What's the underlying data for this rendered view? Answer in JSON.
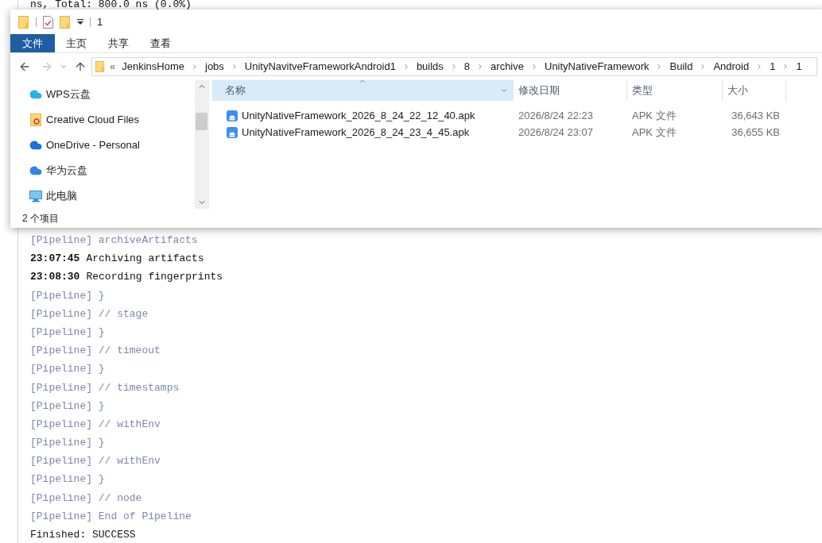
{
  "log": {
    "top_line": "ns, Total: 800.0 ns (0.0%)",
    "lines": [
      {
        "kind": "pipeline",
        "text": "[Pipeline] archiveArtifacts"
      },
      {
        "kind": "timestamped",
        "time": "23:07:45",
        "text": "Archiving artifacts"
      },
      {
        "kind": "timestamped",
        "time": "23:08:30",
        "text": "Recording fingerprints"
      },
      {
        "kind": "pipeline",
        "text": "[Pipeline] }"
      },
      {
        "kind": "pipeline",
        "text": "[Pipeline] // stage"
      },
      {
        "kind": "pipeline",
        "text": "[Pipeline] }"
      },
      {
        "kind": "pipeline",
        "text": "[Pipeline] // timeout"
      },
      {
        "kind": "pipeline",
        "text": "[Pipeline] }"
      },
      {
        "kind": "pipeline",
        "text": "[Pipeline] // timestamps"
      },
      {
        "kind": "pipeline",
        "text": "[Pipeline] }"
      },
      {
        "kind": "pipeline",
        "text": "[Pipeline] // withEnv"
      },
      {
        "kind": "pipeline",
        "text": "[Pipeline] }"
      },
      {
        "kind": "pipeline",
        "text": "[Pipeline] // withEnv"
      },
      {
        "kind": "pipeline",
        "text": "[Pipeline] }"
      },
      {
        "kind": "pipeline",
        "text": "[Pipeline] // node"
      },
      {
        "kind": "pipeline",
        "text": "[Pipeline] End of Pipeline"
      },
      {
        "kind": "plain",
        "text": "Finished: SUCCESS"
      }
    ]
  },
  "explorer": {
    "window": {
      "title": "1"
    },
    "ribbon_tabs": [
      {
        "label": "文件",
        "selected": true
      },
      {
        "label": "主页",
        "selected": false
      },
      {
        "label": "共享",
        "selected": false
      },
      {
        "label": "查看",
        "selected": false
      }
    ],
    "navigation": {
      "forward_disabled": true
    },
    "address": {
      "overflow": "«",
      "crumbs": [
        "JenkinsHome",
        "jobs",
        "UnityNavitveFrameworkAndroid1",
        "builds",
        "8",
        "archive",
        "UnityNativeFramework",
        "Build",
        "Android",
        "1",
        "1"
      ]
    },
    "sidebar": {
      "items": [
        {
          "label": "WPS云盘",
          "kind": "wps"
        },
        {
          "label": "Creative Cloud Files",
          "kind": "creative"
        },
        {
          "label": "OneDrive - Personal",
          "kind": "onedrive"
        },
        {
          "label": "华为云盘",
          "kind": "huawei"
        },
        {
          "label": "此电脑",
          "kind": "pc"
        }
      ]
    },
    "table": {
      "columns": [
        {
          "label": "名称",
          "sorted": true
        },
        {
          "label": "修改日期",
          "sorted": false
        },
        {
          "label": "类型",
          "sorted": false
        },
        {
          "label": "大小",
          "sorted": false
        }
      ],
      "rows": [
        {
          "name": "UnityNativeFramework_2026_8_24_22_12_40.apk",
          "modified": "2026/8/24 22:23",
          "type": "APK 文件",
          "size": "36,643 KB"
        },
        {
          "name": "UnityNativeFramework_2026_8_24_23_4_45.apk",
          "modified": "2026/8/24 23:07",
          "type": "APK 文件",
          "size": "36,655 KB"
        }
      ]
    },
    "status_bar": "2 个项目"
  }
}
